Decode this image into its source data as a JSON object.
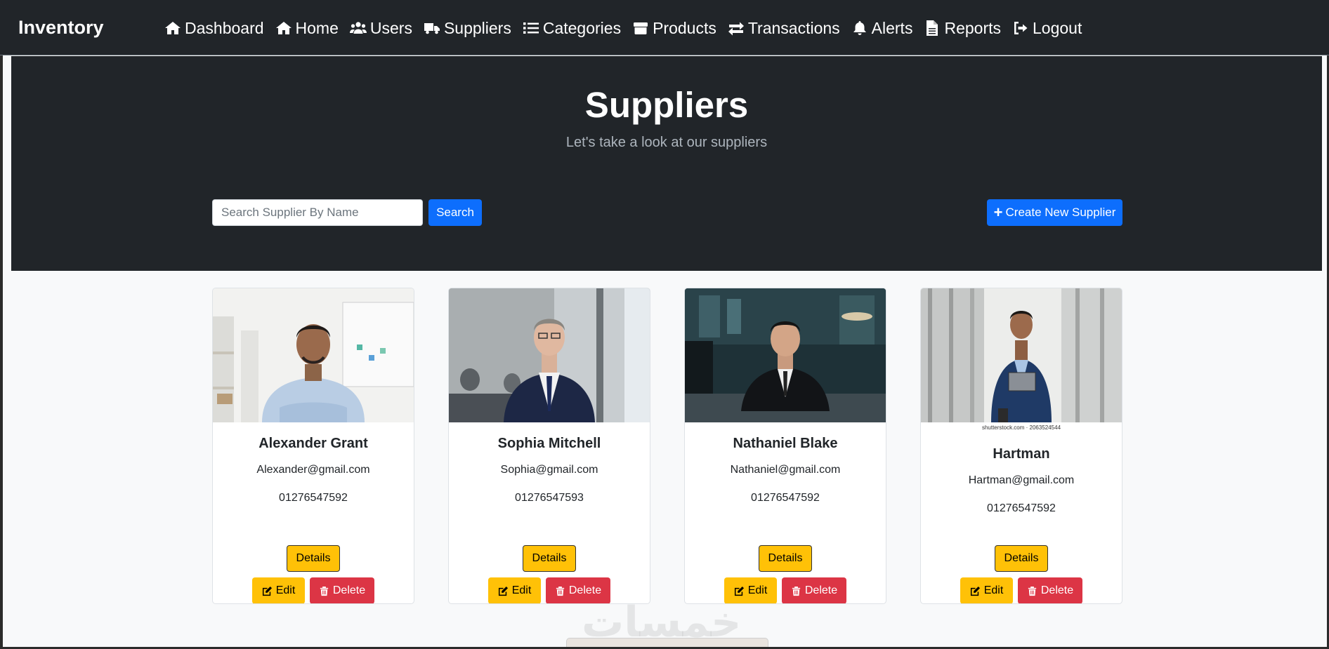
{
  "navbar": {
    "brand": "Inventory",
    "items": [
      {
        "label": "Dashboard",
        "icon": "home-icon"
      },
      {
        "label": "Home",
        "icon": "home-icon"
      },
      {
        "label": "Users",
        "icon": "users-icon"
      },
      {
        "label": "Suppliers",
        "icon": "truck-icon"
      },
      {
        "label": "Categories",
        "icon": "list-icon"
      },
      {
        "label": "Products",
        "icon": "box-icon"
      },
      {
        "label": "Transactions",
        "icon": "exchange-icon"
      },
      {
        "label": "Alerts",
        "icon": "bell-icon"
      },
      {
        "label": "Reports",
        "icon": "file-icon"
      },
      {
        "label": "Logout",
        "icon": "logout-icon"
      }
    ]
  },
  "hero": {
    "title": "Suppliers",
    "subtitle": "Let's take a look at our suppliers"
  },
  "search": {
    "placeholder": "Search Supplier By Name",
    "value": "",
    "button_label": "Search"
  },
  "create_button": {
    "label": "Create New Supplier",
    "icon": "plus-icon"
  },
  "suppliers": [
    {
      "name": "Alexander Grant",
      "email": "Alexander@gmail.com",
      "phone": "01276547592"
    },
    {
      "name": "Sophia Mitchell",
      "email": "Sophia@gmail.com",
      "phone": "01276547593"
    },
    {
      "name": "Nathaniel Blake",
      "email": "Nathaniel@gmail.com",
      "phone": "01276547592"
    },
    {
      "name": "Hartman",
      "email": "Hartman@gmail.com",
      "phone": "01276547592",
      "photo_credit": "shutterstock.com · 2063524544"
    }
  ],
  "card_actions": {
    "details": "Details",
    "edit": "Edit",
    "delete": "Delete"
  },
  "watermark": "خمسات",
  "colors": {
    "navbar_bg": "#212529",
    "primary": "#0d6efd",
    "warning": "#ffc107",
    "danger": "#dc3545",
    "page_bg": "#f8f9fa"
  }
}
